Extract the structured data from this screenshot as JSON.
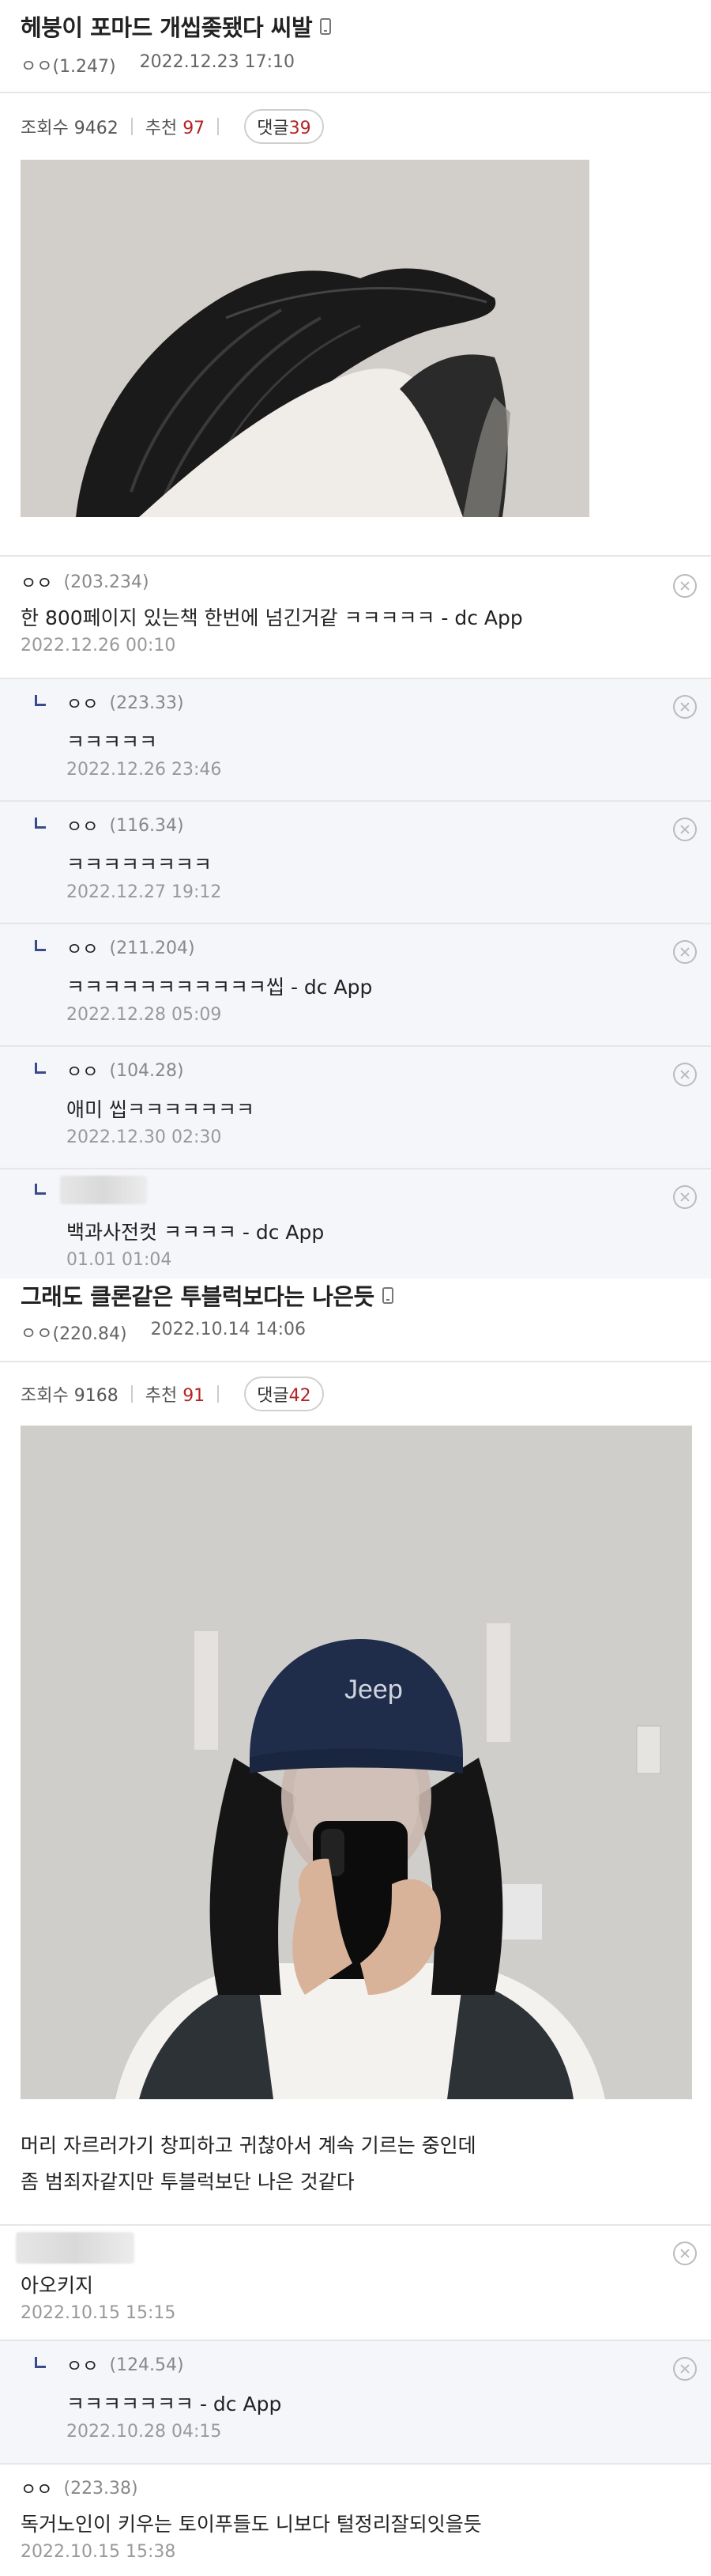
{
  "post1": {
    "title": "헤붕이 포마드 개씹좆됐다 씨발",
    "author": "ㅇㅇ(1.247)",
    "date": "2022.12.23 17:10",
    "views_label": "조회수 9462",
    "rec_label": "추천",
    "rec_value": "97",
    "comment_label": "댓글",
    "comment_count": "39",
    "comments": [
      {
        "nick": "ㅇㅇ",
        "ip": "(203.234)",
        "text": "한 800페이지 있는책 한번에 넘긴거같    ㅋㅋㅋㅋㅋ - dc App",
        "date": "2022.12.26 00:10"
      },
      {
        "nick": "ㅇㅇ",
        "ip": "(223.33)",
        "text": "ㅋㅋㅋㅋㅋ",
        "date": "2022.12.26 23:46"
      },
      {
        "nick": "ㅇㅇ",
        "ip": "(116.34)",
        "text": "ㅋㅋㅋㅋㅋㅋㅋㅋ",
        "date": "2022.12.27 19:12"
      },
      {
        "nick": "ㅇㅇ",
        "ip": "(211.204)",
        "text": "ㅋㅋㅋㅋㅋㅋㅋㅋㅋㅋㅋ씹 - dc App",
        "date": "2022.12.28 05:09"
      },
      {
        "nick": "ㅇㅇ",
        "ip": "(104.28)",
        "text": "애미 씹ㅋㅋㅋㅋㅋㅋㅋ",
        "date": "2022.12.30 02:30"
      },
      {
        "nick": "",
        "ip": "",
        "text": "백과사전컷 ㅋㅋㅋㅋ - dc App",
        "date": "01.01 01:04"
      }
    ]
  },
  "post2": {
    "title": "그래도 클론같은 투블럭보다는 나은듯",
    "author": "ㅇㅇ(220.84)",
    "date": "2022.10.14 14:06",
    "views_label": "조회수 9168",
    "rec_label": "추천",
    "rec_value": "91",
    "comment_label": "댓글",
    "comment_count": "42",
    "body_line1": "머리 자르러가기 창피하고 귀찮아서 계속 기르는 중인데",
    "body_line2": "좀 범죄자같지만 투블럭보단 나은 것같다",
    "cap_text": "Jeep",
    "comments": [
      {
        "nick": "",
        "ip": "",
        "text": "아오키지",
        "date": "2022.10.15 15:15"
      },
      {
        "nick": "ㅇㅇ",
        "ip": "(124.54)",
        "text": "ㅋㅋㅋㅋㅋㅋㅋ - dc App",
        "date": "2022.10.28 04:15"
      },
      {
        "nick": "ㅇㅇ",
        "ip": "(223.38)",
        "text": "독거노인이 키우는 토이푸들도 니보다 털정리잘되잇을듯",
        "date": "2022.10.15 15:38"
      }
    ]
  }
}
